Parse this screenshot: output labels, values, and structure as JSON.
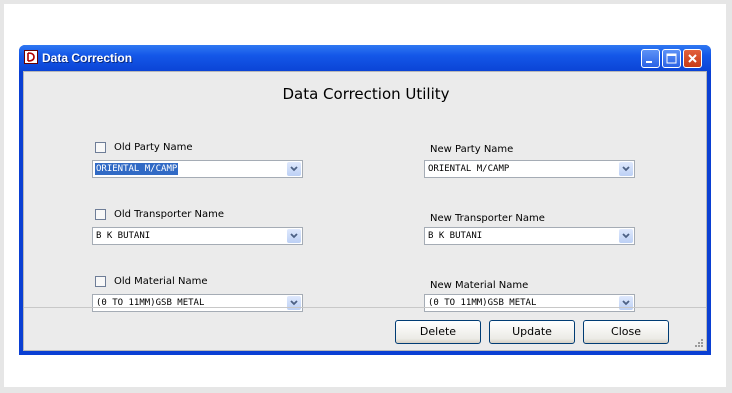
{
  "window": {
    "title": "Data Correction"
  },
  "heading": "Data Correction Utility",
  "left": {
    "party": {
      "label": "Old Party Name",
      "value": "ORIENTAL M/CAMP"
    },
    "transporter": {
      "label": "Old Transporter Name",
      "value": "B K BUTANI"
    },
    "material": {
      "label": "Old Material Name",
      "value": "(0 TO 11MM)GSB METAL"
    }
  },
  "right": {
    "party": {
      "label": "New Party Name",
      "value": "ORIENTAL M/CAMP"
    },
    "transporter": {
      "label": "New Transporter Name",
      "value": "B K BUTANI"
    },
    "material": {
      "label": "New Material Name",
      "value": "(0 TO 11MM)GSB METAL"
    }
  },
  "buttons": {
    "delete": "Delete",
    "update": "Update",
    "close": "Close"
  }
}
